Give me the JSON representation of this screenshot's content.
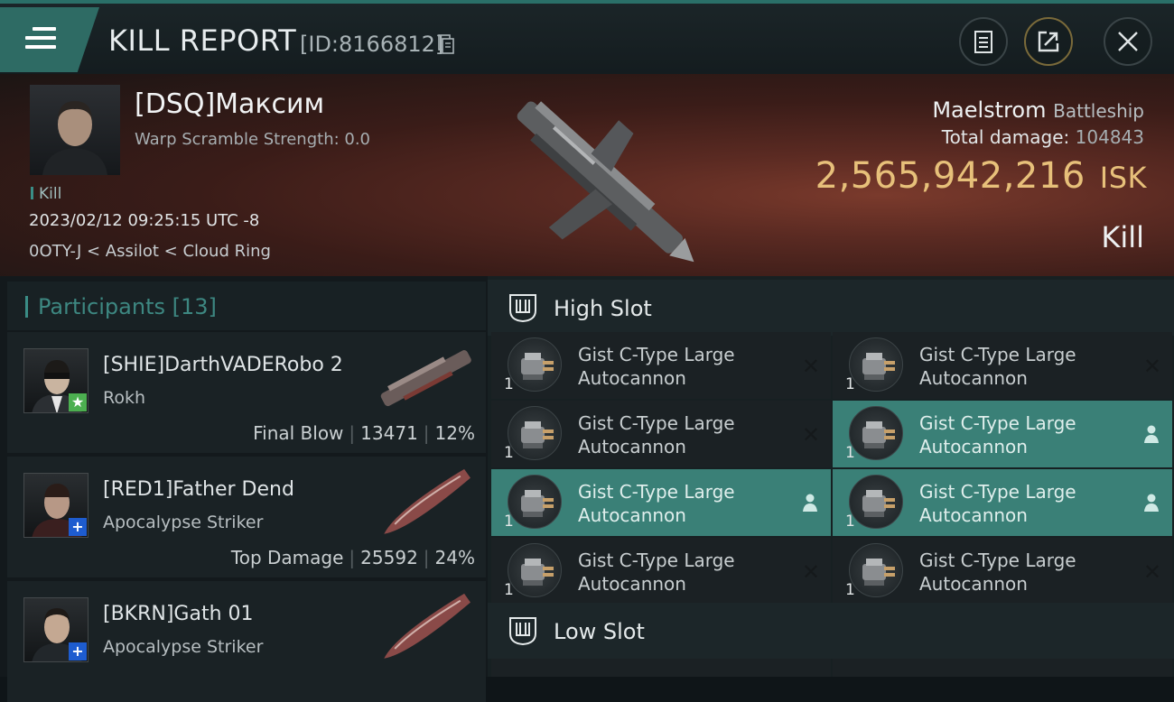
{
  "window": {
    "title": "KILL REPORT",
    "report_id": "[ID:8166812]"
  },
  "victim": {
    "name": "[DSQ]Максим",
    "warp_scramble": "Warp Scramble Strength: 0.0",
    "tag": "Kill",
    "datetime": "2023/02/12 09:25:15 UTC -8",
    "location": "0OTY-J < Assilot < Cloud Ring",
    "ship": "Maelstrom",
    "ship_class": "Battleship",
    "total_damage_label": "Total damage:",
    "total_damage": "104843",
    "isk_value": "2,565,942,216",
    "isk_unit": "ISK",
    "result": "Kill"
  },
  "participants": {
    "title": "Participants",
    "count": "[13]",
    "rows": [
      {
        "name": "[SHIE]DarthVADERobo 2",
        "ship": "Rokh",
        "role": "Final Blow",
        "damage": "13471",
        "percent": "12%",
        "badge": "★",
        "badge_color": "#4caf50"
      },
      {
        "name": "[RED1]Father Dend",
        "ship": "Apocalypse Striker",
        "role": "Top Damage",
        "damage": "25592",
        "percent": "24%",
        "badge": "+",
        "badge_color": "#1e5ccf"
      },
      {
        "name": "[BKRN]Gath 01",
        "ship": "Apocalypse Striker",
        "badge": "+",
        "badge_color": "#1e5ccf"
      }
    ]
  },
  "slots": {
    "high": {
      "title": "High Slot",
      "modules": [
        {
          "name": "Gist C-Type Large Autocannon",
          "qty": "1",
          "state": "destroyed"
        },
        {
          "name": "Gist C-Type Large Autocannon",
          "qty": "1",
          "state": "destroyed"
        },
        {
          "name": "Gist C-Type Large Autocannon",
          "qty": "1",
          "state": "destroyed"
        },
        {
          "name": "Gist C-Type Large Autocannon",
          "qty": "1",
          "state": "dropped"
        },
        {
          "name": "Gist C-Type Large Autocannon",
          "qty": "1",
          "state": "dropped"
        },
        {
          "name": "Gist C-Type Large Autocannon",
          "qty": "1",
          "state": "dropped"
        },
        {
          "name": "Gist C-Type Large Autocannon",
          "qty": "1",
          "state": "destroyed"
        },
        {
          "name": "Gist C-Type Large Autocannon",
          "qty": "1",
          "state": "destroyed"
        }
      ]
    },
    "low": {
      "title": "Low Slot"
    }
  },
  "colors": {
    "accent": "#3a8077",
    "isk": "#e7c07a",
    "teal_text": "#3d8781"
  },
  "icons": [
    "menu-icon",
    "copy-icon",
    "clipboard-icon",
    "share-icon",
    "close-icon",
    "slot-icon",
    "person-icon",
    "x-icon"
  ]
}
